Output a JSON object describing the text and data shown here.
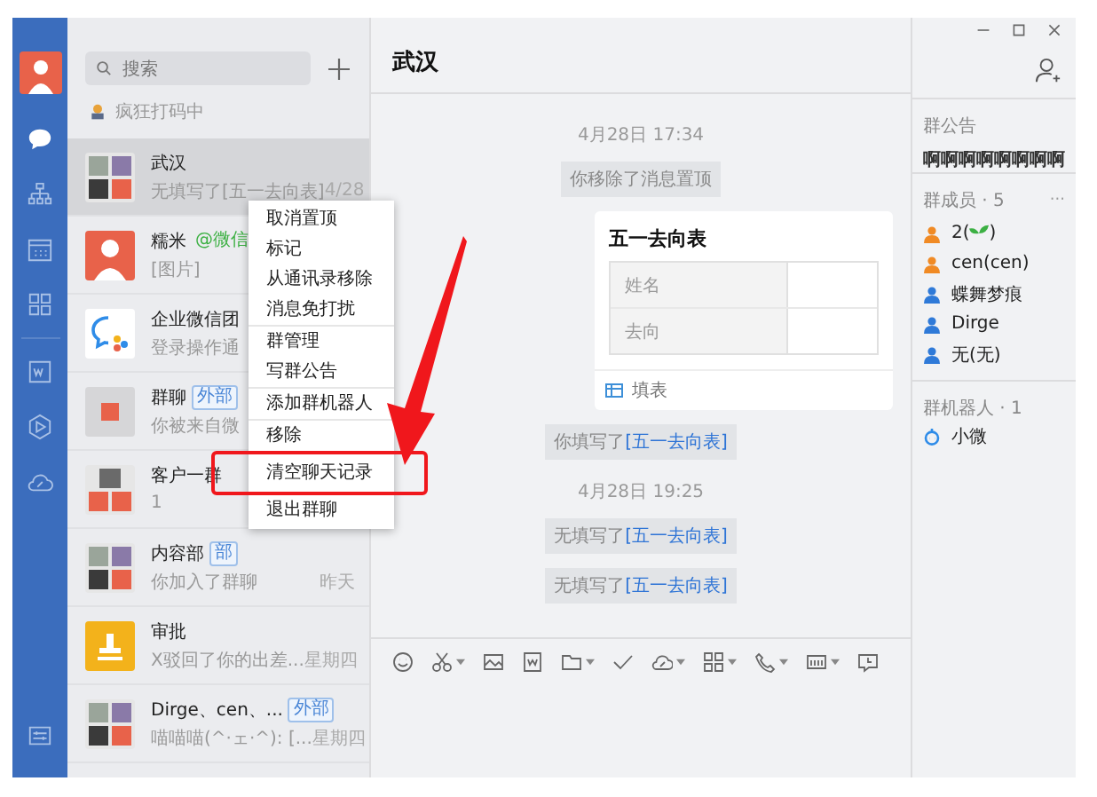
{
  "nav": [
    {
      "selected": true
    },
    {
      "selected": false
    },
    {
      "selected": false
    },
    {
      "selected": false
    },
    {
      "selected": false
    },
    {
      "selected": false
    },
    {
      "selected": false
    }
  ],
  "search": {
    "placeholder": "搜索"
  },
  "status": "疯狂打码中",
  "chats": [
    {
      "name": "武汉",
      "preview": "无填写了[五一去向表]",
      "time": "4/28",
      "selected": true
    },
    {
      "name": "糯米",
      "tag": "@微信",
      "preview": "[图片]",
      "selected": false
    },
    {
      "name": "企业微信团",
      "preview": "登录操作通",
      "selected": false
    },
    {
      "name": "群聊",
      "tag": "外部",
      "preview": "你被来自微",
      "selected": false
    },
    {
      "name": "客户一群",
      "preview": "1",
      "selected": false
    },
    {
      "name": "内容部",
      "tag": "部",
      "preview": "你加入了群聊",
      "time": "昨天",
      "selected": false
    },
    {
      "name": "审批",
      "preview": "X驳回了你的出差...",
      "time": "星期四",
      "selected": false
    },
    {
      "name": "Dirge、cen、...",
      "tag": "外部",
      "preview": "喵喵喵(^·ェ·^): [...",
      "time": "星期四",
      "selected": false
    }
  ],
  "menu": [
    [
      {
        "label": "取消置顶",
        "marked": false
      },
      {
        "label": "标记",
        "marked": false
      },
      {
        "label": "从通讯录移除",
        "marked": false
      },
      {
        "label": "消息免打扰",
        "marked": false
      }
    ],
    [
      {
        "label": "群管理",
        "marked": false
      },
      {
        "label": "写群公告",
        "marked": false
      }
    ],
    [
      {
        "label": "添加群机器人",
        "marked": false
      }
    ],
    [
      {
        "label": "移除",
        "marked": false
      },
      {
        "label": "清空聊天记录",
        "marked": true
      },
      {
        "label": "退出群聊",
        "marked": false
      }
    ]
  ],
  "chat": {
    "title": "武汉",
    "messages": [
      {
        "kind": "time",
        "text": "4月28日 17:34"
      },
      {
        "kind": "system",
        "text": "你移除了消息置顶"
      },
      {
        "kind": "card",
        "title": "五一去向表",
        "fields": [
          "姓名",
          "去向"
        ],
        "action": "填表"
      },
      {
        "kind": "system",
        "text": "你填写了",
        "link": "[五一去向表]"
      },
      {
        "kind": "time",
        "text": "4月28日 19:25"
      },
      {
        "kind": "system",
        "text": "无填写了",
        "link": "[五一去向表]"
      },
      {
        "kind": "system",
        "text": "无填写了",
        "link": "[五一去向表]"
      }
    ],
    "tools": [
      {
        "dropdown": false
      },
      {
        "dropdown": true
      },
      {
        "dropdown": false
      },
      {
        "dropdown": false
      },
      {
        "dropdown": true
      },
      {
        "dropdown": false
      },
      {
        "dropdown": true
      },
      {
        "dropdown": true
      },
      {
        "dropdown": true
      },
      {
        "dropdown": true
      },
      {
        "dropdown": false
      }
    ]
  },
  "side": {
    "notice_title": "群公告",
    "notice": "啊啊啊啊啊啊啊啊",
    "members_title": "群成员 · 5",
    "more": "···",
    "members": [
      {
        "name": "2(",
        "suffix": ")",
        "color": "#f08a24"
      },
      {
        "name": "cen(cen)",
        "color": "#f08a24"
      },
      {
        "name": "蝶舞梦痕",
        "color": "#2f7ad8"
      },
      {
        "name": "Dirge",
        "color": "#2f7ad8"
      },
      {
        "name": "无(无)",
        "color": "#2f7ad8"
      }
    ],
    "robots_title": "群机器人 · 1",
    "robots": [
      "小微"
    ]
  }
}
